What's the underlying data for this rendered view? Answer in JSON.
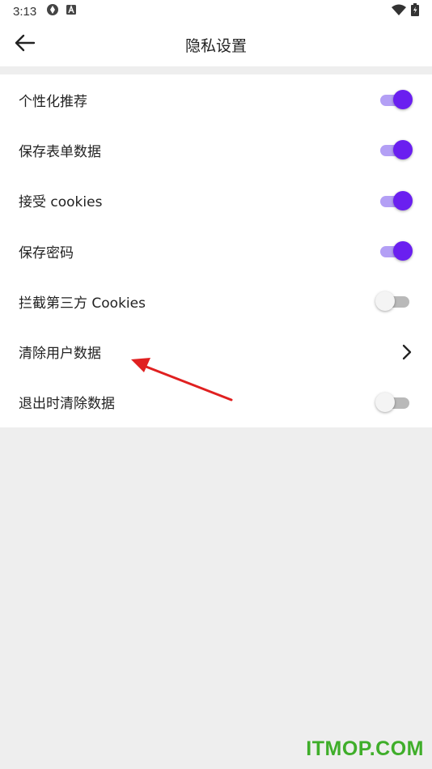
{
  "status_bar": {
    "time": "3:13",
    "left_icons": [
      "sync-icon",
      "a-badge-icon"
    ],
    "right_icons": [
      "wifi-icon",
      "battery-charging-icon"
    ]
  },
  "header": {
    "title": "隐私设置",
    "back_icon": "arrow-left-icon"
  },
  "settings": [
    {
      "label": "个性化推荐",
      "control": "switch",
      "enabled": true
    },
    {
      "label": "保存表单数据",
      "control": "switch",
      "enabled": true
    },
    {
      "label": "接受 cookies",
      "control": "switch",
      "enabled": true
    },
    {
      "label": "保存密码",
      "control": "switch",
      "enabled": true
    },
    {
      "label": "拦截第三方 Cookies",
      "control": "switch",
      "enabled": false
    },
    {
      "label": "清除用户数据",
      "control": "chevron",
      "icon": "chevron-right-icon"
    },
    {
      "label": "退出时清除数据",
      "control": "switch",
      "enabled": false
    }
  ],
  "colors": {
    "switch_on_thumb": "#6a1ff0",
    "switch_on_track": "#b39ff5",
    "annotation_arrow": "#e02020",
    "watermark": "#3fae2a"
  },
  "watermark": {
    "text": "ITMOP.COM"
  }
}
